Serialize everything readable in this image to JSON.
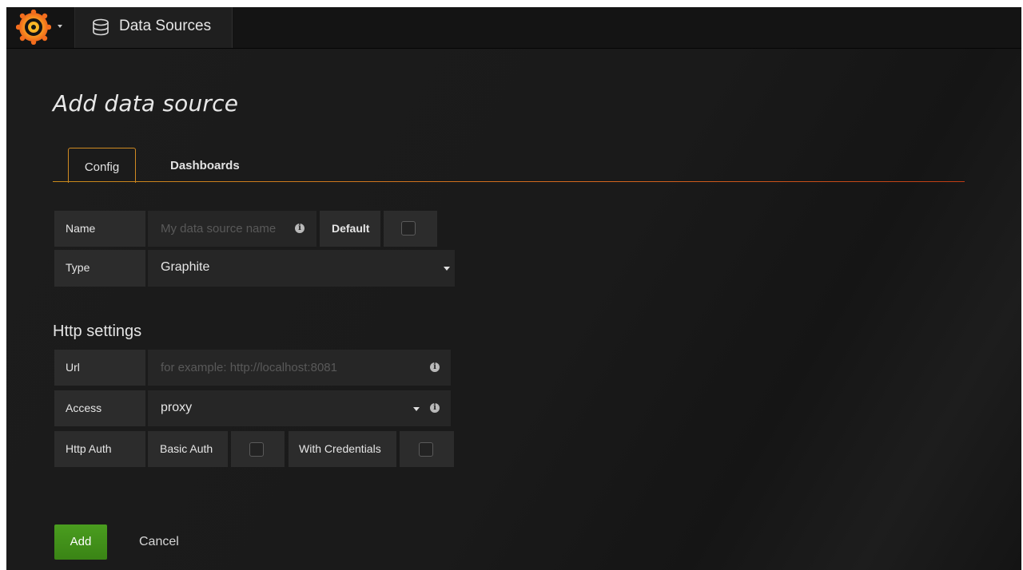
{
  "topbar": {
    "section_title": "Data Sources"
  },
  "page": {
    "title": "Add data source"
  },
  "tabs": [
    {
      "label": "Config",
      "active": true
    },
    {
      "label": "Dashboards",
      "active": false
    }
  ],
  "form": {
    "name_label": "Name",
    "name_placeholder": "My data source name",
    "default_label": "Default",
    "default_checked": false,
    "type_label": "Type",
    "type_value": "Graphite"
  },
  "http_settings": {
    "title": "Http settings",
    "url_label": "Url",
    "url_placeholder": "for example: http://localhost:8081",
    "access_label": "Access",
    "access_value": "proxy",
    "auth_label": "Http Auth",
    "basic_auth_label": "Basic Auth",
    "basic_auth_checked": false,
    "with_credentials_label": "With Credentials",
    "with_credentials_checked": false
  },
  "actions": {
    "add_label": "Add",
    "cancel_label": "Cancel"
  },
  "colors": {
    "accent": "#eb7b18",
    "primary_button": "#3f8a17",
    "background": "#1a1a1a"
  },
  "icons": {
    "logo": "grafana-logo-icon",
    "nav": "database-icon",
    "info": "info-icon"
  }
}
